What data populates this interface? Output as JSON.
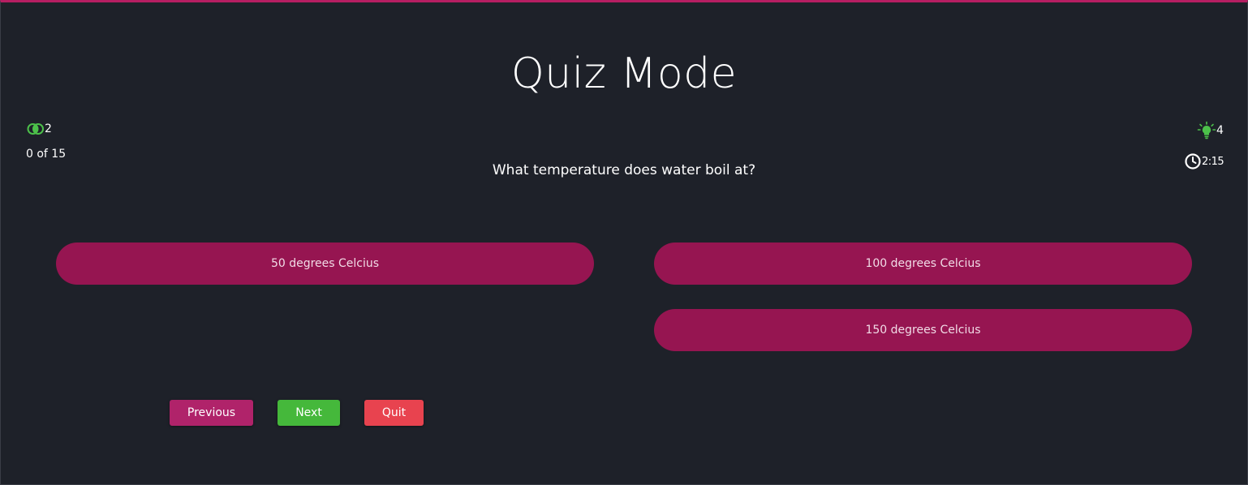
{
  "title": "Quiz Mode",
  "lifelines": {
    "fifty_fifty_count": "2",
    "fifty_fifty_icon": "fifty-fifty-icon",
    "hints_count": "4",
    "hints_icon": "lightbulb-icon"
  },
  "progress": "0 of 15",
  "timer": {
    "icon": "clock-icon",
    "value": "2:15"
  },
  "question": "What temperature does water boil at?",
  "options": [
    "50 degrees Celcius",
    "100 degrees Celcius",
    "150 degrees Celcius"
  ],
  "buttons": {
    "previous": "Previous",
    "next": "Next",
    "quit": "Quit"
  },
  "colors": {
    "background": "#1e2129",
    "accent": "#b61e62",
    "option": "#961551",
    "previous": "#b0236a",
    "next": "#45b83b",
    "quit": "#e8434f",
    "icon_green": "#4cc04a"
  }
}
